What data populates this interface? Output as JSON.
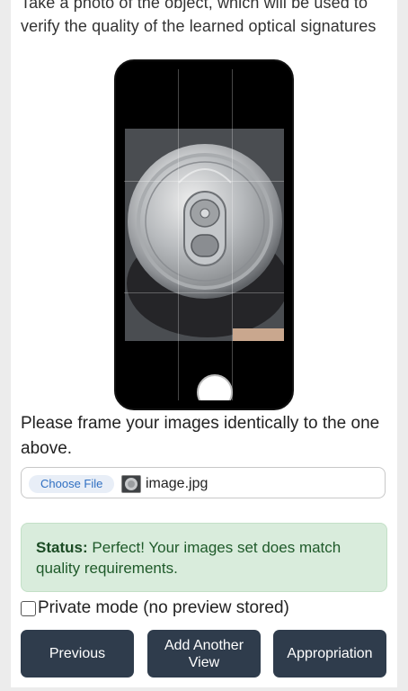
{
  "intro_text": "Take a photo of the object, which will be used to verify the quality of the learned optical signatures",
  "frame_instruction": "Please frame your images identically to the one above.",
  "file_input": {
    "button_label": "Choose File",
    "file_name": "image.jpg"
  },
  "status": {
    "label": "Status:",
    "message": "Perfect! Your images set does match quality requirements."
  },
  "private_mode": {
    "label": "Private mode (no preview stored)",
    "checked": false
  },
  "buttons": {
    "previous": "Previous",
    "add_view": "Add Another View",
    "appropriation": "Appropriation"
  },
  "colors": {
    "button_bg": "#2f3c4c",
    "status_bg": "#d9ecdc",
    "status_text": "#1f5a2a",
    "link_blue": "#2f6fc2"
  }
}
